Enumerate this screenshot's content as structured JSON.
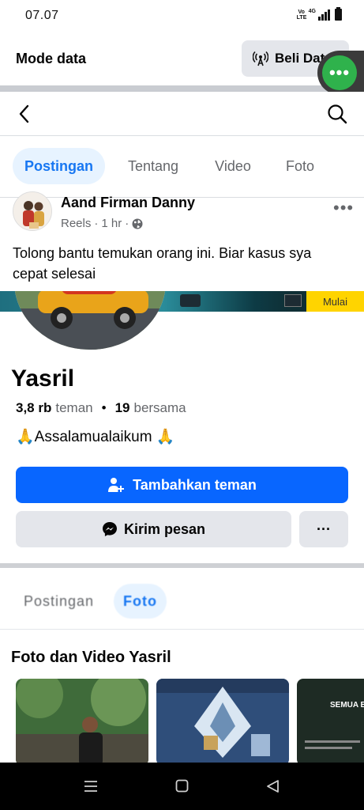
{
  "status_bar": {
    "time": "07.07",
    "volte_label": "Vo LTE",
    "network_label": "4G"
  },
  "data_banner": {
    "label": "Mode data",
    "buy_button_label": "Beli Data"
  },
  "tabs": [
    {
      "label": "Postingan",
      "active": true
    },
    {
      "label": "Tentang",
      "active": false
    },
    {
      "label": "Video",
      "active": false
    },
    {
      "label": "Foto",
      "active": false
    }
  ],
  "post": {
    "author": "Aand Firman Danny",
    "type": "Reels",
    "time": "1 hr",
    "separator": "·",
    "text": "Tolong bantu temukan orang ini. Biar kasus sya  cepat selesai"
  },
  "shared_profile": {
    "cover_button": "Mulai",
    "name": "Yasril",
    "friends_count": "3,8 rb",
    "friends_label": "teman",
    "stat_separator": "•",
    "mutual_count": "19",
    "mutual_label": "bersama",
    "bio": "🙏Assalamualaikum 🙏",
    "add_friend_label": "Tambahkan teman",
    "message_label": "Kirim pesan",
    "more_label": "···",
    "inner_tabs": [
      {
        "label": "Postingan",
        "active": false
      },
      {
        "label": "Foto",
        "active": true
      }
    ],
    "photos_title": "Foto dan Video Yasril",
    "thumb3_text": "SEMUA BISA BE"
  },
  "colors": {
    "accent": "#0866ff",
    "tab_active_bg": "#e7f3ff",
    "tab_active_text": "#1877f2",
    "chat_bubble": "#2fb24c",
    "gray_button": "#e4e6eb"
  }
}
